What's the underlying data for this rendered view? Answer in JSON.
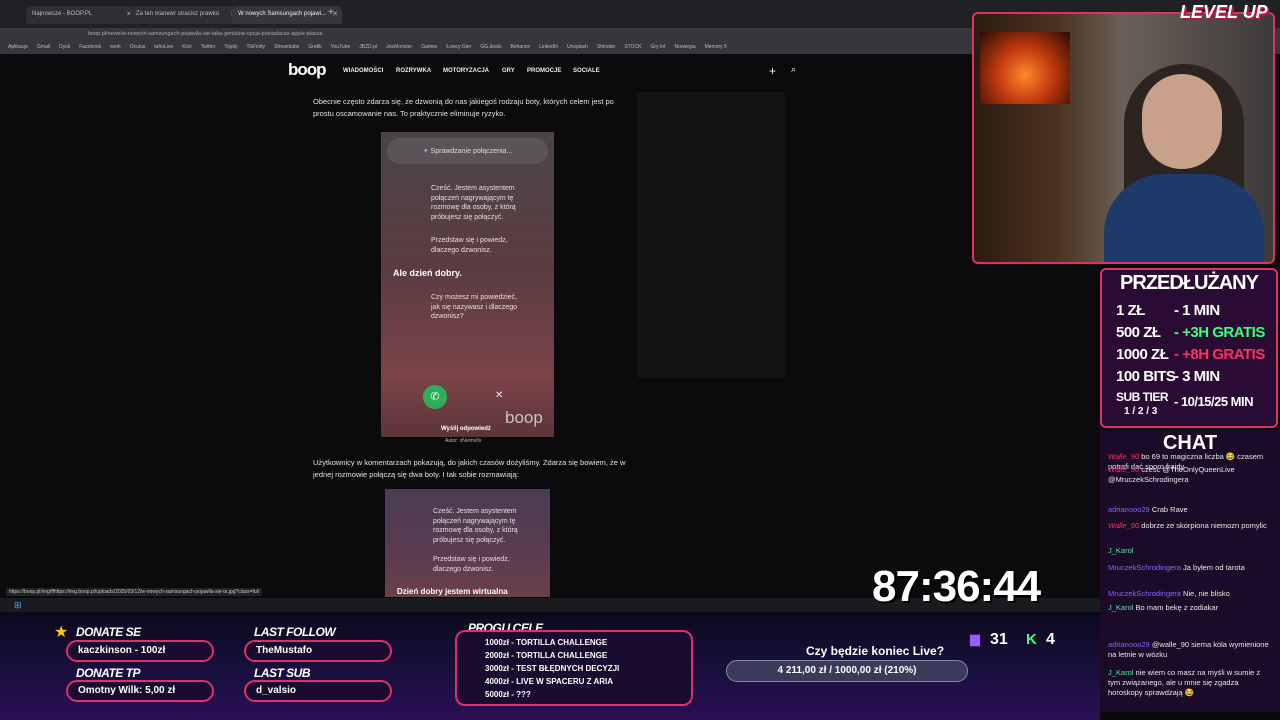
{
  "browser": {
    "tabs": [
      {
        "label": "Najnowsze - BOOP.PL"
      },
      {
        "label": "Za ten manewr stracisz prawko"
      },
      {
        "label": "W nowych Samsungach pojawi..."
      }
    ],
    "url": "boop.pl/news/w-nowych-samsungach-pojawila-sie-taka-genialna-opcja-posiadacze-apple-placza",
    "bookmarks": [
      "Aplikacje",
      "Gmail",
      "Dysk",
      "Facebook",
      "work",
      "Oculus",
      "tahoLive",
      "Kick",
      "Twitter",
      "Tipply",
      "TikFinity",
      "Streamlabs",
      "Grafik",
      "YouTube",
      "JBZD.pl",
      "JoeMonster",
      "Games",
      "Łowcy Gier",
      "GG.deals",
      "Behance",
      "LinkedIn",
      "Unsplash",
      "Shindan",
      "STOCK",
      "Gry Int",
      "Norwegia",
      "Memory 5"
    ],
    "status_url": "https://boop.pl/img/ffhttps://img.boop.pl/uploads/2025/03/12/w-nowych-samsungach-pojawila-sie-ta.jpg?class=full"
  },
  "site": {
    "logo": "boop",
    "nav": [
      "WIADOMOŚCI",
      "ROZRYWKA",
      "MOTORYZACJA",
      "GRY",
      "PROMOCJE",
      "SOCIALE"
    ],
    "para1": "Obecnie często zdarza się, że dzwonią do nas jakiegoś rodzaju boty, których celem jest po prostu oscamowanie nas. To praktycznie eliminuje ryzyko.",
    "para2": "Użytkownicy w komentarzach pokazują, do jakich czasów dożyliśmy. Zdarza się bowiem, że w jednej rozmowie połączą się dwa boty. I tak sobie rozmawiają:",
    "phone1": {
      "checking": "Sprawdzanie połączenia...",
      "msg1": "Cześć. Jestem asystentem połączeń nagrywającym tę rozmowę dla osoby, z którą próbujesz się połączyć.",
      "msg2": "Przedstaw się i powiedz, dlaczego dzwonisz.",
      "reply": "Ale dzień dobry.",
      "msg3": "Czy możesz mi powiedzieć, jak się nazywasz i dlaczego dzwonisz?",
      "send": "Wyślij odpowiedź",
      "watermark": "boop",
      "author": "Autor: xNvimv0x"
    },
    "phone2": {
      "msg1": "Cześć. Jestem asystentem połączeń nagrywającym tę rozmowę dla osoby, z którą próbujesz się połączyć.",
      "msg2": "Przedstaw się i powiedz, dlaczego dzwonisz.",
      "reply": "Dzień dobry jestem wirtualna"
    }
  },
  "overlay": {
    "brand": "LEVEL UP",
    "prices_title": "PRZEDŁUŻANY",
    "prices": [
      {
        "amount": "1 ZŁ",
        "value": "- 1 MIN",
        "color": "#ffffff"
      },
      {
        "amount": "500 ZŁ",
        "value": "- +3H GRATIS",
        "color": "#3cff7a"
      },
      {
        "amount": "1000 ZŁ",
        "value": "- +8H GRATIS",
        "color": "#ff3060"
      },
      {
        "amount": "100 BITS",
        "value": "- 3 MIN",
        "color": "#ffffff"
      },
      {
        "amount": "SUB TIER",
        "value": "- 10/15/25 MIN",
        "color": "#ffffff"
      }
    ],
    "sub_tiers": "1 / 2 / 3",
    "chat_title": "CHAT",
    "chat": [
      {
        "name": "Walle_90",
        "text": "bo 69 to magiczna liczba 😂 czasem potrafi dać sporo frajdy",
        "cls": "cname"
      },
      {
        "name": "Walle_90",
        "text": "czesc @TheOnlyQueenLive @MruczekSchrodingera",
        "cls": "cname"
      },
      {
        "name": "adrianooo29",
        "text": "Crab Rave",
        "cls": "cname2"
      },
      {
        "name": "Walle_90",
        "text": "dobrze ze skorpiona niemozn pomylic",
        "cls": "cname"
      },
      {
        "name": "J_Karol",
        "text": "",
        "cls": "cname3"
      },
      {
        "name": "MruczekSchrodingera",
        "text": "Ja byłem od tarota",
        "cls": "cname2"
      },
      {
        "name": "MruczekSchrodingera",
        "text": "Nie, nie blisko",
        "cls": "cname2"
      },
      {
        "name": "J_Karol",
        "text": "Bo mam bekę z zodiakar",
        "cls": "cname3"
      },
      {
        "name": "adrianooo29",
        "text": "@walle_90 siema kola wymienione na letnie w wózku",
        "cls": "cname2"
      },
      {
        "name": "J_Karol",
        "text": "nie wiem co masz na myśli w sumie z tym związanego, ale u mnie się zgadza horoskopy sprawdzają 😂",
        "cls": "cname3"
      }
    ],
    "donate_label": "DONATE SE",
    "donate_value": "kaczkinson - 100zł",
    "donate_top_label": "DONATE TP",
    "donate_top_value": "Omotny Wilk: 5,00 zł",
    "last_follow_label": "LAST FOLLOW",
    "last_follow_value": "TheMustafo",
    "last_sub_label": "LAST SUB",
    "last_sub_value": "d_valsio",
    "goals_title": "PROGI I CELE",
    "goals": [
      "1000zł - TORTILLA CHALLENGE",
      "2000zł - TORTILLA CHALLENGE",
      "3000zł - TEST BŁĘDNYCH DECYZJI",
      "4000zł - LIVE W SPACERU Z ARIA",
      "5000zł - ???"
    ],
    "timer": "87:36:44",
    "question": "Czy będzie koniec Live?",
    "donation_progress": "4 211,00 zł / 1000,00 zł (210%)",
    "viewers": "31",
    "kick_count": "4"
  }
}
